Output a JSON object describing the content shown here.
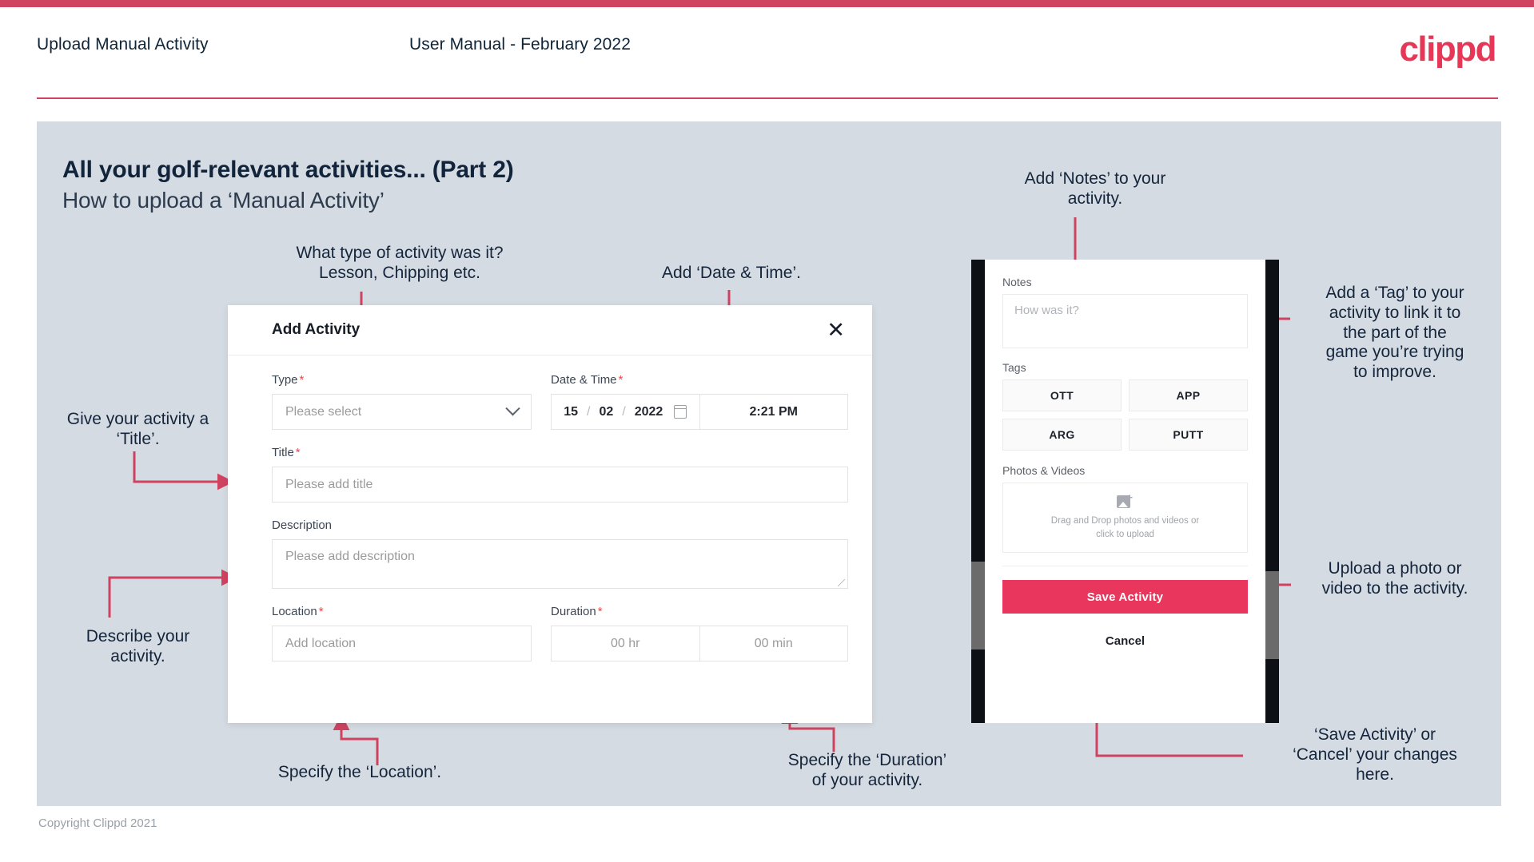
{
  "header": {
    "title": "Upload Manual Activity",
    "subtitle": "User Manual - February 2022",
    "logo": "clippd"
  },
  "slide": {
    "title": "All your golf-relevant activities... (Part 2)",
    "subtitle": "How to upload a ‘Manual Activity’"
  },
  "annotations": {
    "type": "What type of activity was it?\nLesson, Chipping etc.",
    "datetime": "Add ‘Date & Time’.",
    "title": "Give your activity a\n‘Title’.",
    "describe": "Describe your\nactivity.",
    "location": "Specify the ‘Location’.",
    "duration": "Specify the ‘Duration’\nof your activity.",
    "notes": "Add ‘Notes’ to your\nactivity.",
    "tag": "Add a ‘Tag’ to your\nactivity to link it to\nthe part of the\ngame you’re trying\nto improve.",
    "upload": "Upload a photo or\nvideo to the activity.",
    "save": "‘Save Activity’ or\n‘Cancel’ your changes\nhere."
  },
  "dialog": {
    "title": "Add Activity",
    "close_icon": "close-icon",
    "type": {
      "label": "Type",
      "required": "*",
      "placeholder": "Please select"
    },
    "datetime": {
      "label": "Date & Time",
      "required": "*",
      "day": "15",
      "month": "02",
      "year": "2022",
      "sep": "/",
      "time": "2:21 PM"
    },
    "title_field": {
      "label": "Title",
      "required": "*",
      "placeholder": "Please add title"
    },
    "description": {
      "label": "Description",
      "placeholder": "Please add description"
    },
    "location": {
      "label": "Location",
      "required": "*",
      "placeholder": "Add location"
    },
    "duration": {
      "label": "Duration",
      "required": "*",
      "hours": "00 hr",
      "minutes": "00 min"
    }
  },
  "phone": {
    "notes": {
      "label": "Notes",
      "placeholder": "How was it?"
    },
    "tags": {
      "label": "Tags",
      "items": [
        "OTT",
        "APP",
        "ARG",
        "PUTT"
      ]
    },
    "photos": {
      "label": "Photos & Videos",
      "drop_line1": "Drag and Drop photos and videos or",
      "drop_line2": "click to upload",
      "icon": "image-add-icon"
    },
    "save_button": "Save Activity",
    "cancel_button": "Cancel"
  },
  "footer": {
    "copyright": "Copyright Clippd 2021"
  },
  "colors": {
    "brand_pink": "#e8365d",
    "top_bar": "#cf4360",
    "arrow": "#cf4360",
    "panel_bg": "#d5dbe2",
    "text_dark": "#14253c",
    "required": "#e8484f"
  }
}
